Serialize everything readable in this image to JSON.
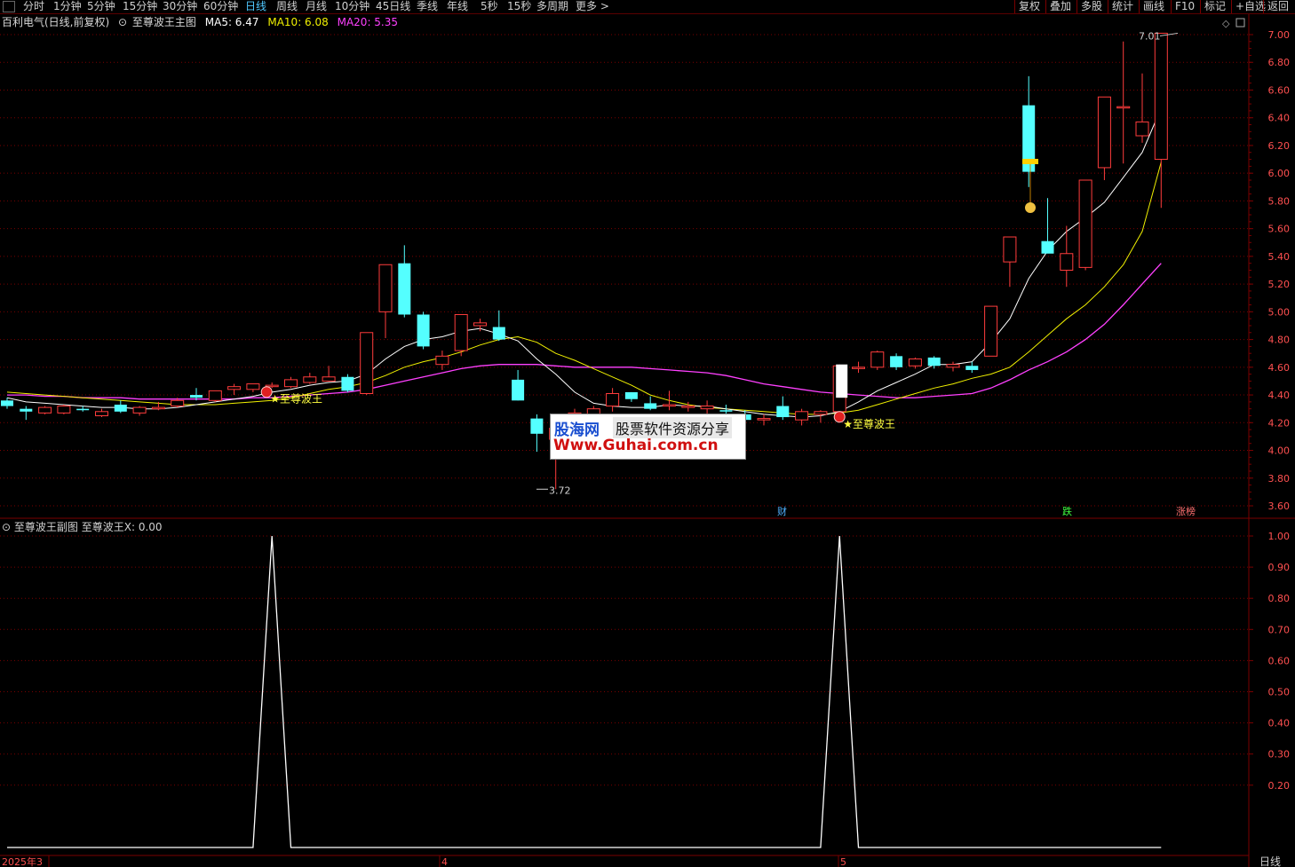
{
  "toolbar": {
    "periods": [
      "分时",
      "1分钟",
      "5分钟",
      "15分钟",
      "30分钟",
      "60分钟",
      "日线",
      "周线",
      "月线",
      "10分钟",
      "45日线",
      "季线",
      "年线",
      "5秒",
      "15秒",
      "多周期",
      "更多 >"
    ],
    "active_period": "日线",
    "right_buttons": [
      "复权",
      "叠加",
      "多股",
      "统计",
      "画线",
      "F10",
      "标记",
      "+自选",
      "返回"
    ]
  },
  "main_legend": {
    "stock": "百利电气(日线,前复权)",
    "indicator": "至尊波王主图",
    "ma5": "MA5: 6.47",
    "ma10": "MA10: 6.08",
    "ma20": "MA20: 5.35"
  },
  "sub_legend": {
    "indicator": "至尊波王副图",
    "value": "至尊波王X: 0.00"
  },
  "annotations": {
    "signal_label": "至尊波王",
    "high_label": "7.01",
    "low_label": "3.72",
    "marker_cai": "财",
    "marker_die": "跌",
    "marker_zhangbang": "涨榜"
  },
  "watermark": {
    "brand": "股海网",
    "tagline": "股票软件资源分享",
    "url": "Www.Guhai.com.cn"
  },
  "x_axis": {
    "start": "2025年3",
    "month4": "4",
    "month5": "5",
    "period_label": "日线"
  },
  "colors": {
    "up": "#ff3c3c",
    "down": "#54ffff",
    "ma5": "#ffffff",
    "ma10": "#f0f000",
    "ma20": "#ff40ff",
    "grid": "#7a0000",
    "axis_text": "#ff5050"
  },
  "chart_data": [
    {
      "type": "candlestick",
      "title": "至尊波王主图",
      "ylim": [
        3.5,
        7.1
      ],
      "y_ticks": [
        "7.00",
        "6.80",
        "6.60",
        "6.40",
        "6.20",
        "6.00",
        "5.80",
        "5.60",
        "5.40",
        "5.20",
        "5.00",
        "4.80",
        "4.60",
        "4.40",
        "4.20",
        "4.00",
        "3.80",
        "3.60"
      ],
      "candles": [
        {
          "o": 4.36,
          "h": 4.38,
          "l": 4.3,
          "c": 4.32
        },
        {
          "o": 4.3,
          "h": 4.32,
          "l": 4.22,
          "c": 4.28
        },
        {
          "o": 4.27,
          "h": 4.32,
          "l": 4.26,
          "c": 4.31
        },
        {
          "o": 4.27,
          "h": 4.33,
          "l": 4.26,
          "c": 4.32
        },
        {
          "o": 4.3,
          "h": 4.32,
          "l": 4.28,
          "c": 4.29
        },
        {
          "o": 4.25,
          "h": 4.3,
          "l": 4.24,
          "c": 4.28
        },
        {
          "o": 4.33,
          "h": 4.36,
          "l": 4.27,
          "c": 4.28
        },
        {
          "o": 4.27,
          "h": 4.32,
          "l": 4.25,
          "c": 4.31
        },
        {
          "o": 4.3,
          "h": 4.35,
          "l": 4.29,
          "c": 4.31
        },
        {
          "o": 4.32,
          "h": 4.38,
          "l": 4.31,
          "c": 4.36
        },
        {
          "o": 4.4,
          "h": 4.45,
          "l": 4.36,
          "c": 4.38
        },
        {
          "o": 4.36,
          "h": 4.43,
          "l": 4.35,
          "c": 4.43
        },
        {
          "o": 4.44,
          "h": 4.48,
          "l": 4.4,
          "c": 4.46
        },
        {
          "o": 4.44,
          "h": 4.48,
          "l": 4.42,
          "c": 4.48
        },
        {
          "o": 4.46,
          "h": 4.49,
          "l": 4.45,
          "c": 4.47
        },
        {
          "o": 4.46,
          "h": 4.53,
          "l": 4.45,
          "c": 4.51
        },
        {
          "o": 4.49,
          "h": 4.56,
          "l": 4.48,
          "c": 4.53
        },
        {
          "o": 4.5,
          "h": 4.61,
          "l": 4.5,
          "c": 4.53
        },
        {
          "o": 4.53,
          "h": 4.55,
          "l": 4.42,
          "c": 4.43
        },
        {
          "o": 4.41,
          "h": 4.85,
          "l": 4.4,
          "c": 4.85
        },
        {
          "o": 5.0,
          "h": 5.34,
          "l": 4.81,
          "c": 5.34
        },
        {
          "o": 5.35,
          "h": 5.48,
          "l": 4.96,
          "c": 4.98
        },
        {
          "o": 4.98,
          "h": 5.0,
          "l": 4.73,
          "c": 4.75
        },
        {
          "o": 4.62,
          "h": 4.72,
          "l": 4.58,
          "c": 4.68
        },
        {
          "o": 4.72,
          "h": 4.95,
          "l": 4.68,
          "c": 4.98
        },
        {
          "o": 4.9,
          "h": 4.95,
          "l": 4.86,
          "c": 4.92
        },
        {
          "o": 4.89,
          "h": 5.01,
          "l": 4.79,
          "c": 4.8
        },
        {
          "o": 4.51,
          "h": 4.58,
          "l": 4.36,
          "c": 4.36
        },
        {
          "o": 4.23,
          "h": 4.26,
          "l": 3.99,
          "c": 4.12
        },
        {
          "o": 4.08,
          "h": 4.26,
          "l": 3.72,
          "c": 4.16
        },
        {
          "o": 4.22,
          "h": 4.3,
          "l": 4.16,
          "c": 4.27
        },
        {
          "o": 4.26,
          "h": 4.32,
          "l": 4.24,
          "c": 4.3
        },
        {
          "o": 4.32,
          "h": 4.45,
          "l": 4.28,
          "c": 4.41
        },
        {
          "o": 4.42,
          "h": 4.42,
          "l": 4.35,
          "c": 4.37
        },
        {
          "o": 4.34,
          "h": 4.39,
          "l": 4.29,
          "c": 4.3
        },
        {
          "o": 4.32,
          "h": 4.43,
          "l": 4.29,
          "c": 4.33
        },
        {
          "o": 4.31,
          "h": 4.35,
          "l": 4.28,
          "c": 4.32
        },
        {
          "o": 4.3,
          "h": 4.36,
          "l": 4.26,
          "c": 4.32
        },
        {
          "o": 4.29,
          "h": 4.33,
          "l": 4.25,
          "c": 4.28
        },
        {
          "o": 4.26,
          "h": 4.29,
          "l": 4.22,
          "c": 4.22
        },
        {
          "o": 4.22,
          "h": 4.26,
          "l": 4.18,
          "c": 4.23
        },
        {
          "o": 4.32,
          "h": 4.39,
          "l": 4.22,
          "c": 4.24
        },
        {
          "o": 4.22,
          "h": 4.3,
          "l": 4.18,
          "c": 4.28
        },
        {
          "o": 4.26,
          "h": 4.29,
          "l": 4.2,
          "c": 4.28
        },
        {
          "o": 4.28,
          "h": 4.62,
          "l": 4.28,
          "c": 4.61
        },
        {
          "o": 4.6,
          "h": 4.64,
          "l": 4.56,
          "c": 4.6
        },
        {
          "o": 4.6,
          "h": 4.72,
          "l": 4.58,
          "c": 4.71
        },
        {
          "o": 4.68,
          "h": 4.7,
          "l": 4.58,
          "c": 4.6
        },
        {
          "o": 4.61,
          "h": 4.67,
          "l": 4.59,
          "c": 4.66
        },
        {
          "o": 4.67,
          "h": 4.68,
          "l": 4.59,
          "c": 4.61
        },
        {
          "o": 4.6,
          "h": 4.64,
          "l": 4.57,
          "c": 4.62
        },
        {
          "o": 4.61,
          "h": 4.64,
          "l": 4.56,
          "c": 4.58
        },
        {
          "o": 4.68,
          "h": 5.04,
          "l": 4.68,
          "c": 5.04
        },
        {
          "o": 5.36,
          "h": 5.54,
          "l": 5.18,
          "c": 5.54
        },
        {
          "o": 6.49,
          "h": 6.7,
          "l": 5.9,
          "c": 6.01
        },
        {
          "o": 5.51,
          "h": 5.82,
          "l": 5.44,
          "c": 5.42
        },
        {
          "o": 5.3,
          "h": 5.62,
          "l": 5.18,
          "c": 5.42
        },
        {
          "o": 5.32,
          "h": 5.95,
          "l": 5.3,
          "c": 5.95
        },
        {
          "o": 6.04,
          "h": 6.55,
          "l": 5.95,
          "c": 6.55
        },
        {
          "o": 6.48,
          "h": 6.95,
          "l": 6.07,
          "c": 6.48
        },
        {
          "o": 6.27,
          "h": 6.72,
          "l": 6.22,
          "c": 6.37
        },
        {
          "o": 6.1,
          "h": 7.01,
          "l": 5.75,
          "c": 7.01
        }
      ],
      "ma5": [
        4.38,
        4.35,
        4.34,
        4.33,
        4.32,
        4.31,
        4.31,
        4.3,
        4.3,
        4.31,
        4.33,
        4.35,
        4.37,
        4.39,
        4.42,
        4.44,
        4.47,
        4.49,
        4.5,
        4.55,
        4.66,
        4.75,
        4.8,
        4.82,
        4.86,
        4.88,
        4.84,
        4.79,
        4.66,
        4.55,
        4.42,
        4.34,
        4.32,
        4.31,
        4.31,
        4.33,
        4.32,
        4.32,
        4.3,
        4.28,
        4.26,
        4.25,
        4.24,
        4.25,
        4.28,
        4.35,
        4.43,
        4.49,
        4.55,
        4.62,
        4.62,
        4.64,
        4.78,
        4.95,
        5.24,
        5.44,
        5.58,
        5.68,
        5.79,
        5.97,
        6.15,
        6.47
      ],
      "ma10": [
        4.42,
        4.41,
        4.4,
        4.39,
        4.38,
        4.37,
        4.36,
        4.35,
        4.34,
        4.33,
        4.33,
        4.33,
        4.34,
        4.35,
        4.36,
        4.38,
        4.41,
        4.44,
        4.46,
        4.49,
        4.54,
        4.6,
        4.64,
        4.67,
        4.71,
        4.76,
        4.8,
        4.82,
        4.78,
        4.7,
        4.65,
        4.59,
        4.53,
        4.47,
        4.4,
        4.36,
        4.33,
        4.31,
        4.3,
        4.29,
        4.28,
        4.27,
        4.26,
        4.26,
        4.27,
        4.29,
        4.33,
        4.37,
        4.41,
        4.45,
        4.48,
        4.52,
        4.55,
        4.6,
        4.71,
        4.83,
        4.95,
        5.05,
        5.18,
        5.34,
        5.58,
        6.08
      ],
      "ma20": [
        4.4,
        4.4,
        4.39,
        4.39,
        4.38,
        4.38,
        4.38,
        4.37,
        4.37,
        4.37,
        4.37,
        4.37,
        4.37,
        4.38,
        4.38,
        4.39,
        4.4,
        4.41,
        4.42,
        4.44,
        4.47,
        4.5,
        4.53,
        4.56,
        4.59,
        4.61,
        4.62,
        4.62,
        4.62,
        4.61,
        4.6,
        4.6,
        4.6,
        4.6,
        4.59,
        4.58,
        4.57,
        4.56,
        4.54,
        4.51,
        4.48,
        4.46,
        4.44,
        4.42,
        4.41,
        4.4,
        4.39,
        4.38,
        4.38,
        4.39,
        4.4,
        4.41,
        4.45,
        4.51,
        4.58,
        4.64,
        4.71,
        4.8,
        4.91,
        5.05,
        5.2,
        5.35
      ],
      "signals": [
        14,
        44
      ]
    },
    {
      "type": "line",
      "title": "至尊波王副图",
      "series": [
        {
          "name": "至尊波王X",
          "values_description": "zero except spikes to 1.00 at signal bars"
        }
      ],
      "ylim": [
        0,
        1.05
      ],
      "y_ticks": [
        "1.00",
        "0.90",
        "0.80",
        "0.70",
        "0.60",
        "0.50",
        "0.40",
        "0.30",
        "0.20"
      ],
      "spikes": [
        14,
        44
      ],
      "current_value": 0.0
    }
  ]
}
